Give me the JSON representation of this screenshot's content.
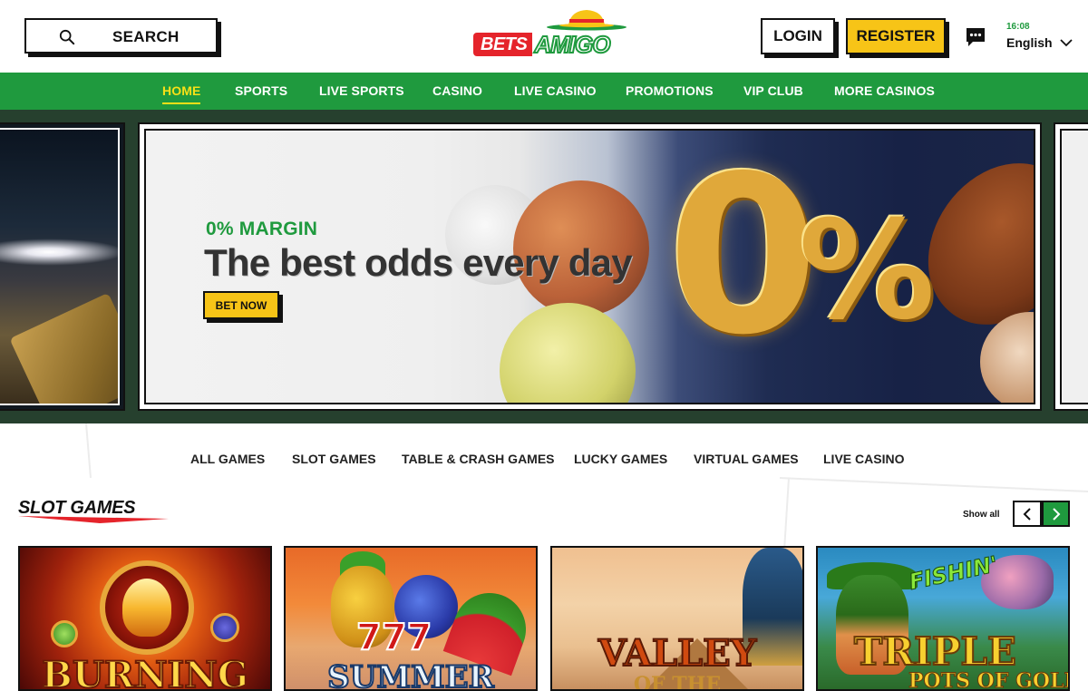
{
  "header": {
    "search_label": "SEARCH",
    "logo": {
      "bets": "BETS",
      "amigo": "AMIGO"
    },
    "login_label": "LOGIN",
    "register_label": "REGISTER",
    "time": "16:08",
    "language": "English"
  },
  "nav": {
    "items": [
      {
        "label": "HOME",
        "active": true
      },
      {
        "label": "SPORTS"
      },
      {
        "label": "LIVE SPORTS"
      },
      {
        "label": "CASINO"
      },
      {
        "label": "LIVE CASINO"
      },
      {
        "label": "PROMOTIONS"
      },
      {
        "label": "VIP CLUB"
      },
      {
        "label": "MORE CASINOS"
      }
    ]
  },
  "hero": {
    "kicker": "0% MARGIN",
    "headline": "The best odds every day",
    "cta_label": "BET NOW",
    "big_zero": "0",
    "big_percent": "%"
  },
  "game_categories": [
    "ALL GAMES",
    "SLOT GAMES",
    "TABLE & CRASH GAMES",
    "LUCKY GAMES",
    "VIRTUAL GAMES",
    "LIVE CASINO"
  ],
  "slot_section": {
    "title": "SLOT GAMES",
    "show_all": "Show all",
    "games": [
      {
        "title": "BURNING"
      },
      {
        "title": "SUMMER",
        "badge": "777"
      },
      {
        "title": "VALLEY",
        "subtitle": "OF THE"
      },
      {
        "title": "TRIPLE",
        "top": "FISHIN'",
        "subtitle": "POTS OF GOLD"
      }
    ]
  },
  "colors": {
    "brand_green": "#1f9a3e",
    "brand_yellow": "#f7c417",
    "brand_red": "#e5242b",
    "nav_active": "#f7e017",
    "hero_bg": "#26402e"
  }
}
